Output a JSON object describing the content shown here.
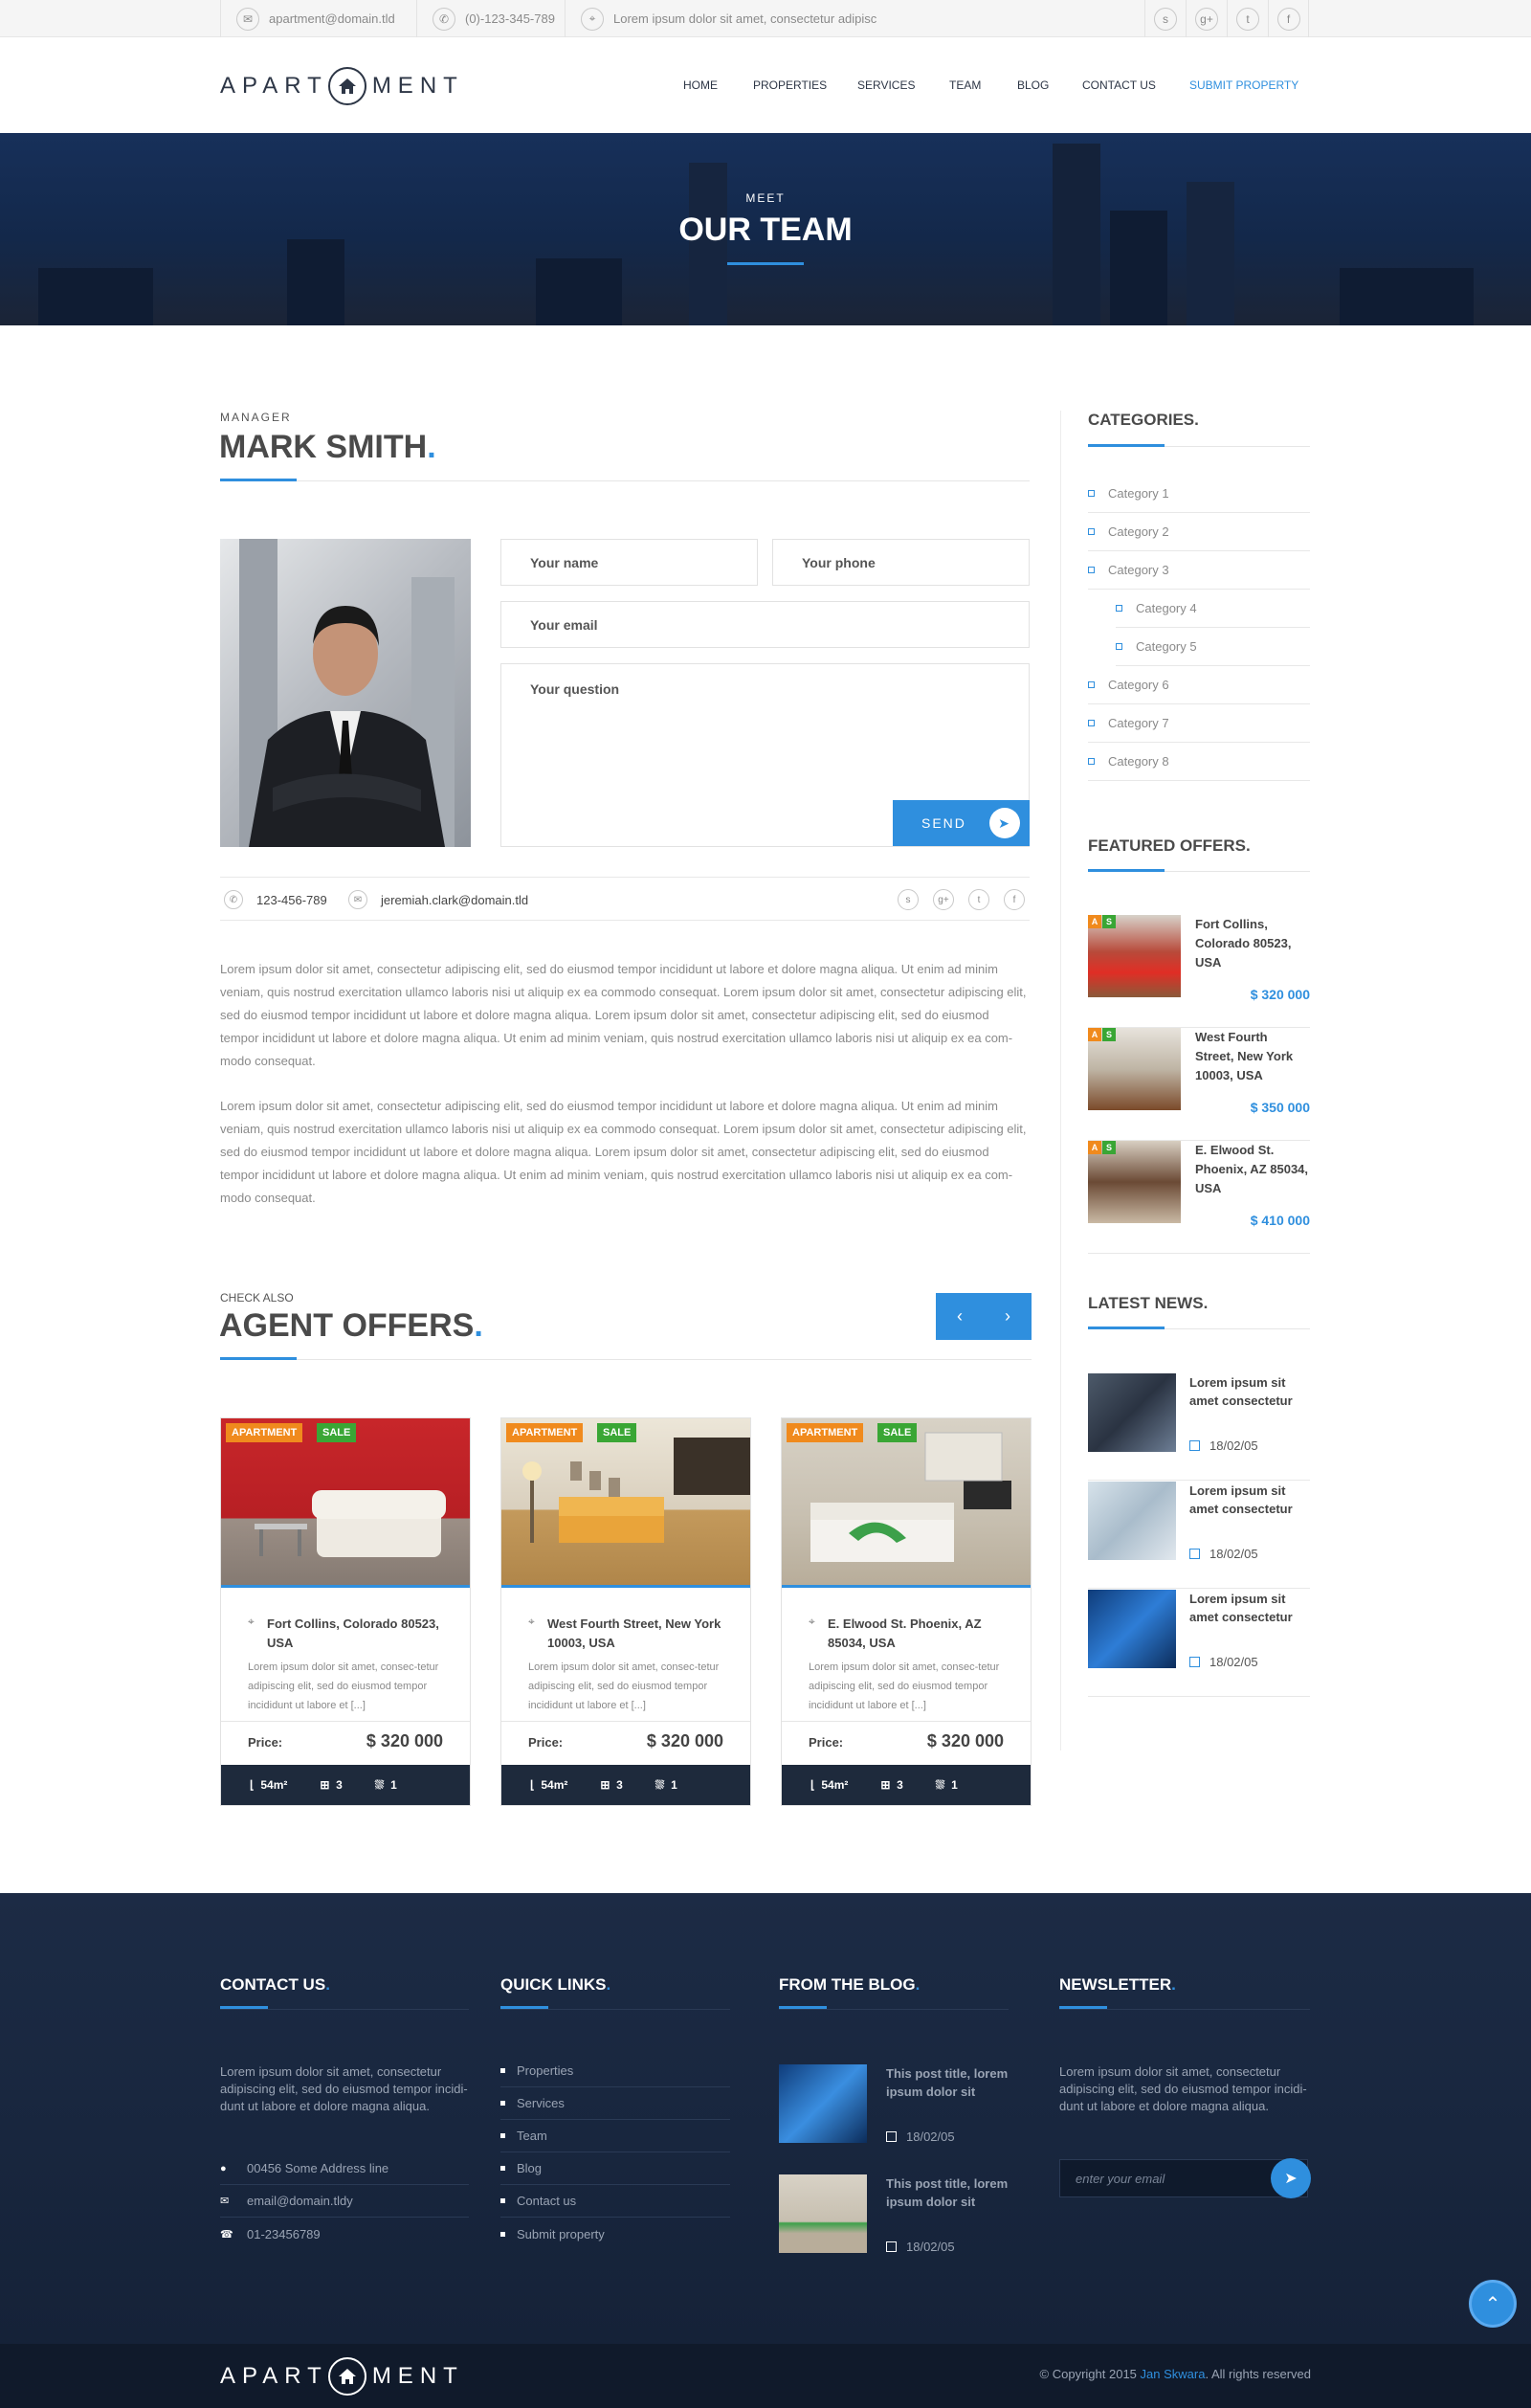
{
  "topbar": {
    "email": "apartment@domain.tld",
    "phone": "(0)-123-345-789",
    "address": "Lorem ipsum dolor sit amet, consectetur adipisc",
    "social": [
      "skype-icon",
      "google-plus-icon",
      "twitter-icon",
      "facebook-icon"
    ]
  },
  "logo": {
    "left": "APART",
    "right": "MENT"
  },
  "nav": [
    "HOME",
    "PROPERTIES",
    "SERVICES",
    "TEAM",
    "BLOG",
    "CONTACT US",
    "SUBMIT PROPERTY"
  ],
  "hero": {
    "sub": "MEET",
    "title": "OUR TEAM"
  },
  "agent": {
    "role": "MANAGER",
    "name": "MARK SMITH",
    "form": {
      "name": "Your name",
      "phone": "Your phone",
      "email": "Your email",
      "question": "Your question",
      "send": "SEND"
    },
    "phone": "123-456-789",
    "email": "jeremiah.clark@domain.tld",
    "paragraphs": [
      "Lorem ipsum dolor sit amet, consectetur adipiscing elit, sed do eiusmod tempor incididunt ut labore et dolore magna aliqua. Ut enim ad minim veniam, quis nostrud exercitation ullamco laboris nisi ut aliquip ex ea commodo consequat. Lorem ipsum dolor sit amet, consectetur adipiscing elit, sed do eiusmod tempor incididunt ut labore et dolore magna aliqua. Lorem ipsum dolor sit amet, consectetur adipiscing elit, sed do eiusmod tempor incididunt ut labore et dolore magna aliqua. Ut enim ad minim veniam, quis nostrud exercitation ullamco laboris nisi ut aliquip ex ea com-modo consequat.",
      "Lorem ipsum dolor sit amet, consectetur adipiscing elit, sed do eiusmod tempor incididunt ut labore et dolore magna aliqua. Ut enim ad minim veniam, quis nostrud exercitation ullamco laboris nisi ut aliquip ex ea commodo consequat. Lorem ipsum dolor sit amet, consectetur adipiscing elit, sed do eiusmod tempor incididunt ut labore et dolore magna aliqua. Lorem ipsum dolor sit amet, consectetur adipiscing elit, sed do eiusmod tempor incididunt ut labore et dolore magna aliqua. Ut enim ad minim veniam, quis nostrud exercitation ullamco laboris nisi ut aliquip ex ea com-modo consequat."
    ]
  },
  "offers": {
    "sub": "CHECK ALSO",
    "title": "AGENT OFFERS",
    "badges": [
      "APARTMENT",
      "SALE"
    ],
    "price_label": "Price:",
    "cards": [
      {
        "address": "Fort Collins, Colorado 80523, USA",
        "desc": "Lorem ipsum dolor sit amet, consec-tetur adipiscing elit, sed do eiusmod tempor incididunt ut labore et [...]",
        "price": "$ 320 000",
        "area": "54m²",
        "rooms": "3",
        "baths": "1"
      },
      {
        "address": "West Fourth Street, New York 10003, USA",
        "desc": "Lorem ipsum dolor sit amet, consec-tetur adipiscing elit, sed do eiusmod tempor incididunt ut labore et [...]",
        "price": "$ 320 000",
        "area": "54m²",
        "rooms": "3",
        "baths": "1"
      },
      {
        "address": "E. Elwood St. Phoenix, AZ 85034, USA",
        "desc": "Lorem ipsum dolor sit amet, consec-tetur adipiscing elit, sed do eiusmod tempor incididunt ut labore et [...]",
        "price": "$ 320 000",
        "area": "54m²",
        "rooms": "3",
        "baths": "1"
      }
    ]
  },
  "sidebar": {
    "categories_title": "CATEGORIES",
    "categories": [
      "Category 1",
      "Category 2",
      "Category 3",
      "Category 4",
      "Category 5",
      "Category 6",
      "Category 7",
      "Category 8"
    ],
    "featured_title": "FEATURED OFFERS",
    "featured": [
      {
        "address": "Fort Collins, Colorado 80523, USA",
        "price": "$ 320 000"
      },
      {
        "address": "West Fourth Street, New York 10003, USA",
        "price": "$ 350 000"
      },
      {
        "address": "E. Elwood St. Phoenix, AZ 85034, USA",
        "price": "$ 410 000"
      }
    ],
    "news_title": "LATEST NEWS",
    "news": [
      {
        "title": "Lorem ipsum sit amet consectetur",
        "date": "18/02/05"
      },
      {
        "title": "Lorem ipsum sit amet consectetur",
        "date": "18/02/05"
      },
      {
        "title": "Lorem ipsum sit amet consectetur",
        "date": "18/02/05"
      }
    ]
  },
  "footer": {
    "contact_title": "CONTACT US",
    "contact_text": "Lorem ipsum dolor sit amet, consectetur adipiscing elit, sed do eiusmod tempor incidi-dunt ut labore et dolore magna aliqua.",
    "address": "00456 Some Address line",
    "email": "email@domain.tldy",
    "phone": "01-23456789",
    "links_title": "QUICK LINKS",
    "links": [
      "Properties",
      "Services",
      "Team",
      "Blog",
      "Contact us",
      "Submit property"
    ],
    "blog_title": "FROM THE BLOG",
    "blog": [
      {
        "title": "This post title, lorem ipsum dolor sit",
        "date": "18/02/05"
      },
      {
        "title": "This post title, lorem ipsum dolor sit",
        "date": "18/02/05"
      }
    ],
    "newsletter_title": "NEWSLETTER",
    "newsletter_text": "Lorem ipsum dolor sit amet, consectetur adipiscing elit, sed do eiusmod tempor incidi-dunt ut labore et dolore magna aliqua.",
    "newsletter_placeholder": "enter your email",
    "copyright_pre": "Copyright 2015",
    "copyright_author": "Jan Skwara",
    "copyright_post": ". All rights reserved"
  },
  "colors": {
    "accent": "#2f8fde",
    "dark": "#1e2a3c",
    "badge_orange": "#f08a1d",
    "badge_green": "#3aa635"
  }
}
